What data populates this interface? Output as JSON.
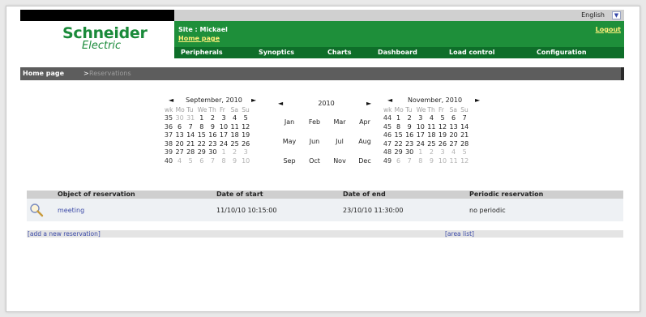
{
  "header": {
    "language": "English",
    "logo_main": "Schneider",
    "logo_sub": "Electric",
    "site_label": "Site : Mickael",
    "home_link": "Home page",
    "logout": "Logout",
    "nav": [
      "Peripherals",
      "Synoptics",
      "Charts",
      "Dashboard",
      "Load control",
      "Configuration"
    ]
  },
  "breadcrumb": {
    "home": "Home page",
    "sep": ">",
    "current": "Reservations"
  },
  "calendars": {
    "prev": "◄",
    "next": "►",
    "sept": {
      "title": "September, 2010",
      "day_headers": [
        "wk",
        "Mo",
        "Tu",
        "We",
        "Th",
        "Fr",
        "Sa",
        "Su"
      ],
      "weeks": [
        [
          "35",
          "30",
          "31",
          "1",
          "2",
          "3",
          "4",
          "5"
        ],
        [
          "36",
          "6",
          "7",
          "8",
          "9",
          "10",
          "11",
          "12"
        ],
        [
          "37",
          "13",
          "14",
          "15",
          "16",
          "17",
          "18",
          "19"
        ],
        [
          "38",
          "20",
          "21",
          "22",
          "23",
          "24",
          "25",
          "26"
        ],
        [
          "39",
          "27",
          "28",
          "29",
          "30",
          "1",
          "2",
          "3"
        ],
        [
          "40",
          "4",
          "5",
          "6",
          "7",
          "8",
          "9",
          "10"
        ]
      ]
    },
    "year": {
      "title": "2010",
      "months": [
        "Jan",
        "Feb",
        "Mar",
        "Apr",
        "May",
        "Jun",
        "Jul",
        "Aug",
        "Sep",
        "Oct",
        "Nov",
        "Dec"
      ]
    },
    "nov": {
      "title": "November, 2010",
      "day_headers": [
        "wk",
        "Mo",
        "Tu",
        "We",
        "Th",
        "Fr",
        "Sa",
        "Su"
      ],
      "weeks": [
        [
          "44",
          "1",
          "2",
          "3",
          "4",
          "5",
          "6",
          "7"
        ],
        [
          "45",
          "8",
          "9",
          "10",
          "11",
          "12",
          "13",
          "14"
        ],
        [
          "46",
          "15",
          "16",
          "17",
          "18",
          "19",
          "20",
          "21"
        ],
        [
          "47",
          "22",
          "23",
          "24",
          "25",
          "26",
          "27",
          "28"
        ],
        [
          "48",
          "29",
          "30",
          "1",
          "2",
          "3",
          "4",
          "5"
        ],
        [
          "49",
          "6",
          "7",
          "8",
          "9",
          "10",
          "11",
          "12"
        ]
      ]
    }
  },
  "table": {
    "headers": [
      "Object of reservation",
      "Date of start",
      "Date of end",
      "Periodic reservation"
    ],
    "rows": [
      {
        "object": "meeting",
        "start": "11/10/10 10:15:00",
        "end": "23/10/10 11:30:00",
        "periodic": "no periodic"
      }
    ]
  },
  "footer": {
    "add": "[add a new reservation]",
    "area": "[area list]"
  },
  "colors": {
    "green": "#1e8f3a",
    "dark_green": "#0e6e29",
    "link_yellow": "#ffef7a",
    "link_blue": "#3b4aa7"
  }
}
